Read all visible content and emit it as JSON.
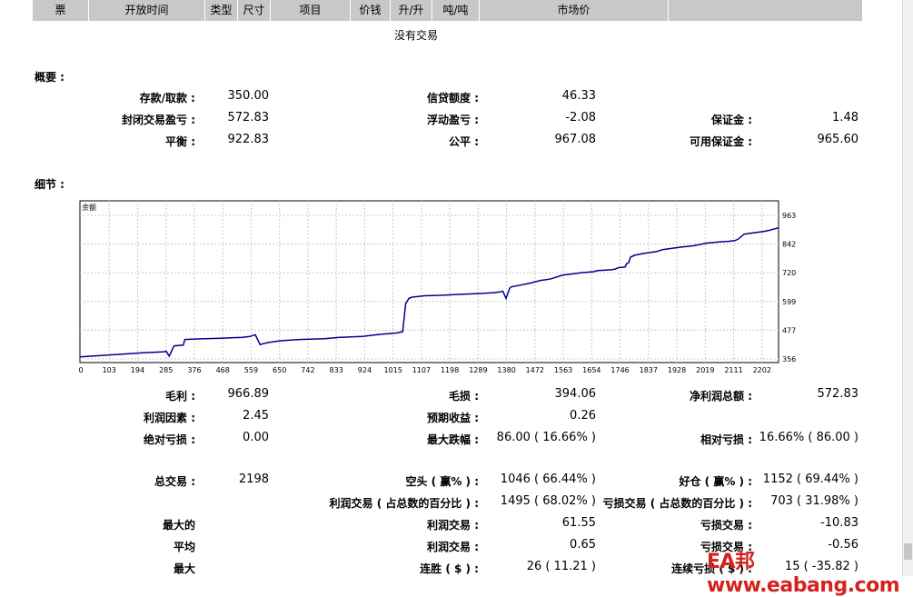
{
  "header": {
    "columns": [
      "票",
      "开放时间",
      "类型",
      "尺寸",
      "项目",
      "价钱",
      "升/升",
      "吨/吨",
      "市场价"
    ]
  },
  "no_trades": "没有交易",
  "summary": {
    "title": "概要 :",
    "rows": [
      [
        {
          "label": "存款/取款 :",
          "value": "350.00"
        },
        {
          "label": "信贷额度 :",
          "value": "46.33"
        },
        {
          "label": "",
          "value": ""
        }
      ],
      [
        {
          "label": "封闭交易盈亏 :",
          "value": "572.83"
        },
        {
          "label": "浮动盈亏 :",
          "value": "-2.08"
        },
        {
          "label": "保证金 :",
          "value": "1.48"
        }
      ],
      [
        {
          "label": "平衡 :",
          "value": "922.83"
        },
        {
          "label": "公平 :",
          "value": "967.08"
        },
        {
          "label": "可用保证金 :",
          "value": "965.60"
        }
      ]
    ]
  },
  "details": {
    "title": "细节 :",
    "rows": [
      [
        {
          "label": "毛利 :",
          "value": "966.89"
        },
        {
          "label": "毛损 :",
          "value": "394.06"
        },
        {
          "label": "净利润总额 :",
          "value": "572.83"
        }
      ],
      [
        {
          "label": "利润因素 :",
          "value": "2.45"
        },
        {
          "label": "预期收益 :",
          "value": "0.26"
        },
        {
          "label": "",
          "value": ""
        }
      ],
      [
        {
          "label": "绝对亏损 :",
          "value": "0.00"
        },
        {
          "label": "最大跌幅 :",
          "value": "86.00 ( 16.66% )"
        },
        {
          "label": "相对亏损 :",
          "value": "16.66% ( 86.00 )"
        }
      ],
      [
        {
          "label": "总交易 :",
          "value": "2198"
        },
        {
          "label": "空头 ( 赢% ) :",
          "value": "1046 ( 66.44% )"
        },
        {
          "label": "好仓 ( 赢% ) :",
          "value": "1152 ( 69.44% )"
        }
      ],
      [
        {
          "label": "",
          "value": ""
        },
        {
          "label": "利润交易 ( 占总数的百分比 ) :",
          "value": "1495 ( 68.02% )"
        },
        {
          "label": "亏损交易 ( 占总数的百分比 ) :",
          "value": "703 ( 31.98% )"
        }
      ],
      [
        {
          "label": "最大的",
          "value": ""
        },
        {
          "label": "利润交易 :",
          "value": "61.55"
        },
        {
          "label": "亏损交易 :",
          "value": "-10.83"
        }
      ],
      [
        {
          "label": "平均",
          "value": ""
        },
        {
          "label": "利润交易 :",
          "value": "0.65"
        },
        {
          "label": "亏损交易 :",
          "value": "-0.56"
        }
      ],
      [
        {
          "label": "最大",
          "value": ""
        },
        {
          "label": "连胜 ( $ ) :",
          "value": "26 ( 11.21 )"
        },
        {
          "label": "连续亏损 ( $ ) :",
          "value": "15 ( -35.82 )"
        }
      ]
    ]
  },
  "chart_data": {
    "type": "line",
    "title": "余额",
    "x_ticks": [
      "0",
      "103",
      "194",
      "285",
      "376",
      "468",
      "559",
      "650",
      "742",
      "833",
      "924",
      "1015",
      "1107",
      "1198",
      "1289",
      "1380",
      "1472",
      "1563",
      "1654",
      "1746",
      "1837",
      "1928",
      "2019",
      "2111",
      "2202"
    ],
    "y_ticks": [
      "963",
      "842",
      "720",
      "599",
      "477",
      "356"
    ],
    "xlim": [
      0,
      2230
    ],
    "ylim": [
      350,
      980
    ],
    "grid": true,
    "series": [
      {
        "color": "#00008b",
        "x": [
          0,
          100,
          200,
          270,
          275,
          285,
          300,
          330,
          335,
          376,
          450,
          520,
          530,
          545,
          550,
          560,
          575,
          580,
          600,
          640,
          700,
          780,
          830,
          900,
          960,
          1010,
          1030,
          1040,
          1050,
          1060,
          1100,
          1150,
          1200,
          1260,
          1290,
          1320,
          1340,
          1350,
          1360,
          1372,
          1377,
          1400,
          1440,
          1470,
          1500,
          1540,
          1550,
          1570,
          1600,
          1640,
          1650,
          1700,
          1710,
          1720,
          1740,
          1745,
          1752,
          1757,
          1770,
          1800,
          1840,
          1860,
          1880,
          1890,
          1920,
          1960,
          2000,
          2040,
          2070,
          2090,
          2100,
          2120,
          2150,
          2180,
          2200,
          2230
        ],
        "y": [
          372,
          380,
          388,
          392,
          395,
          375,
          415,
          418,
          440,
          442,
          445,
          448,
          450,
          452,
          455,
          458,
          420,
          422,
          428,
          435,
          440,
          443,
          448,
          452,
          460,
          465,
          470,
          580,
          600,
          605,
          610,
          612,
          615,
          618,
          620,
          622,
          625,
          628,
          600,
          640,
          645,
          650,
          660,
          670,
          675,
          690,
          692,
          695,
          700,
          704,
          708,
          712,
          715,
          720,
          722,
          735,
          740,
          760,
          768,
          775,
          782,
          790,
          793,
          795,
          800,
          805,
          815,
          820,
          822,
          825,
          830,
          850,
          855,
          860,
          865,
          875
        ]
      }
    ]
  },
  "watermark": "EA邦www.eabang.com"
}
